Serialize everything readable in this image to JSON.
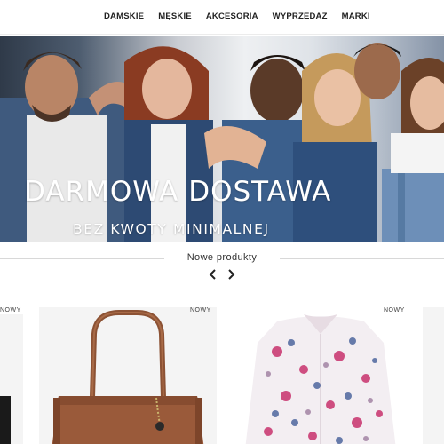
{
  "nav": {
    "items": [
      {
        "label": "DAMSKIE"
      },
      {
        "label": "MĘSKIE"
      },
      {
        "label": "AKCESORIA"
      },
      {
        "label": "WYPRZEDAŻ"
      },
      {
        "label": "MARKI"
      }
    ]
  },
  "hero": {
    "title": "DARMOWA DOSTAWA",
    "subtitle": "BEZ KWOTY MINIMALNEJ"
  },
  "new_products": {
    "heading": "Nowe produkty",
    "prev_icon": "chevron-left-icon",
    "next_icon": "chevron-right-icon",
    "cards": [
      {
        "badge": "NOWY"
      },
      {
        "badge": "NOWY"
      },
      {
        "badge": "NOWY"
      }
    ]
  },
  "colors": {
    "hero_text": "#ffffff",
    "nav_text": "#222222",
    "bag_leather": "#9a5a3a"
  }
}
